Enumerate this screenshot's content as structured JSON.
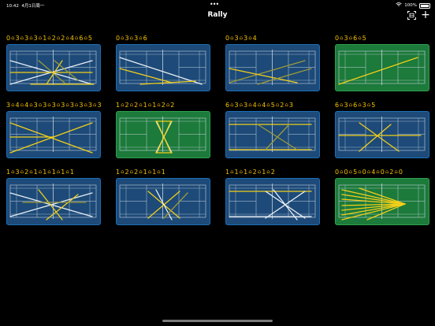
{
  "status_bar": {
    "time": "10:42",
    "date": "4月1日周一",
    "battery": "100%"
  },
  "nav": {
    "title": "Rally",
    "scan_icon": "scan-icon",
    "add_icon": "plus-icon",
    "add_label": "+"
  },
  "court_icon_glyph": "⌂",
  "colors": {
    "background": "#000000",
    "score_yellow": "#f5c400",
    "court_blue": "#1d4a78",
    "court_blue_border": "#1b6fb8",
    "court_green": "#1c7a3a",
    "court_green_border": "#2ea04f",
    "shot_yellow": "#f2cf1a",
    "shot_white": "#e8eef5",
    "shot_olive": "#9c9a3a"
  },
  "rallies": [
    {
      "score": [
        "0",
        "3",
        "3",
        "3",
        "1",
        "2",
        "2",
        "4",
        "6",
        "5"
      ],
      "court": "blue",
      "shots": [
        [
          4,
          20,
          108,
          50,
          "w"
        ],
        [
          4,
          50,
          108,
          20,
          "w"
        ],
        [
          40,
          20,
          75,
          50,
          "o"
        ],
        [
          70,
          20,
          50,
          50,
          "y"
        ],
        [
          4,
          35,
          108,
          35,
          "y"
        ],
        [
          30,
          50,
          110,
          50,
          "y"
        ],
        [
          60,
          20,
          90,
          45,
          "o"
        ]
      ]
    },
    {
      "score": [
        "0",
        "3",
        "3",
        "6"
      ],
      "court": "blue",
      "shots": [
        [
          4,
          16,
          108,
          50,
          "w"
        ],
        [
          4,
          30,
          70,
          48,
          "y"
        ],
        [
          30,
          50,
          100,
          46,
          "y"
        ]
      ]
    },
    {
      "score": [
        "0",
        "3",
        "3",
        "4"
      ],
      "court": "blue",
      "shots": [
        [
          4,
          48,
          100,
          20,
          "o"
        ],
        [
          4,
          30,
          90,
          48,
          "y"
        ],
        [
          40,
          50,
          108,
          30,
          "o"
        ]
      ]
    },
    {
      "score": [
        "0",
        "3",
        "6",
        "5"
      ],
      "court": "green",
      "shots": [
        [
          4,
          50,
          104,
          16,
          "y"
        ]
      ]
    },
    {
      "score": [
        "3",
        "4",
        "4",
        "3",
        "3",
        "3",
        "3",
        "3",
        "3",
        "3",
        "3"
      ],
      "court": "blue",
      "shots": [
        [
          4,
          14,
          108,
          52,
          "y"
        ],
        [
          4,
          52,
          108,
          14,
          "y"
        ],
        [
          4,
          32,
          60,
          32,
          "y"
        ]
      ]
    },
    {
      "score": [
        "1",
        "2",
        "2",
        "1",
        "1",
        "2",
        "2"
      ],
      "court": "green",
      "shots": [
        [
          50,
          12,
          70,
          52,
          "w"
        ],
        [
          70,
          12,
          50,
          52,
          "w"
        ],
        [
          50,
          12,
          70,
          12,
          "y"
        ],
        [
          50,
          52,
          70,
          52,
          "y"
        ],
        [
          51,
          12,
          69,
          52,
          "y"
        ],
        [
          69,
          12,
          51,
          52,
          "y"
        ]
      ]
    },
    {
      "score": [
        "6",
        "3",
        "3",
        "4",
        "4",
        "5",
        "2",
        "3"
      ],
      "court": "blue",
      "shots": [
        [
          4,
          48,
          108,
          48,
          "y"
        ],
        [
          4,
          16,
          108,
          16,
          "y"
        ],
        [
          40,
          16,
          90,
          48,
          "o"
        ],
        [
          50,
          48,
          80,
          16,
          "o"
        ]
      ]
    },
    {
      "score": [
        "6",
        "3",
        "6",
        "3",
        "5"
      ],
      "court": "blue",
      "shots": [
        [
          30,
          14,
          80,
          50,
          "y"
        ],
        [
          30,
          50,
          70,
          16,
          "y"
        ],
        [
          4,
          30,
          108,
          30,
          "y"
        ]
      ]
    },
    {
      "score": [
        "1",
        "3",
        "2",
        "1",
        "1",
        "1",
        "1",
        "1"
      ],
      "court": "blue",
      "shots": [
        [
          4,
          18,
          108,
          48,
          "w"
        ],
        [
          4,
          48,
          108,
          18,
          "w"
        ],
        [
          40,
          14,
          70,
          52,
          "y"
        ],
        [
          50,
          52,
          90,
          20,
          "y"
        ],
        [
          20,
          30,
          100,
          30,
          "o"
        ]
      ]
    },
    {
      "score": [
        "1",
        "2",
        "2",
        "1",
        "1",
        "1"
      ],
      "court": "blue",
      "shots": [
        [
          40,
          16,
          80,
          50,
          "y"
        ],
        [
          40,
          50,
          80,
          16,
          "y"
        ],
        [
          50,
          14,
          70,
          52,
          "w"
        ],
        [
          60,
          50,
          90,
          18,
          "o"
        ]
      ]
    },
    {
      "score": [
        "1",
        "1",
        "1",
        "2",
        "1",
        "2"
      ],
      "court": "blue",
      "shots": [
        [
          4,
          16,
          108,
          16,
          "y"
        ],
        [
          50,
          16,
          100,
          50,
          "w"
        ],
        [
          50,
          50,
          100,
          16,
          "w"
        ],
        [
          60,
          14,
          90,
          52,
          "w"
        ],
        [
          4,
          48,
          108,
          48,
          "w"
        ]
      ]
    },
    {
      "score": [
        "0",
        "0",
        "5",
        "0",
        "4",
        "0",
        "2",
        "0"
      ],
      "court": "green",
      "shots": [
        [
          8,
          14,
          88,
          32,
          "y"
        ],
        [
          8,
          20,
          88,
          32,
          "y"
        ],
        [
          8,
          26,
          88,
          32,
          "y"
        ],
        [
          8,
          34,
          88,
          32,
          "y"
        ],
        [
          8,
          40,
          88,
          32,
          "y"
        ],
        [
          8,
          46,
          88,
          32,
          "y"
        ],
        [
          8,
          52,
          88,
          32,
          "y"
        ],
        [
          30,
          12,
          88,
          32,
          "y"
        ],
        [
          40,
          52,
          88,
          32,
          "y"
        ]
      ]
    }
  ]
}
